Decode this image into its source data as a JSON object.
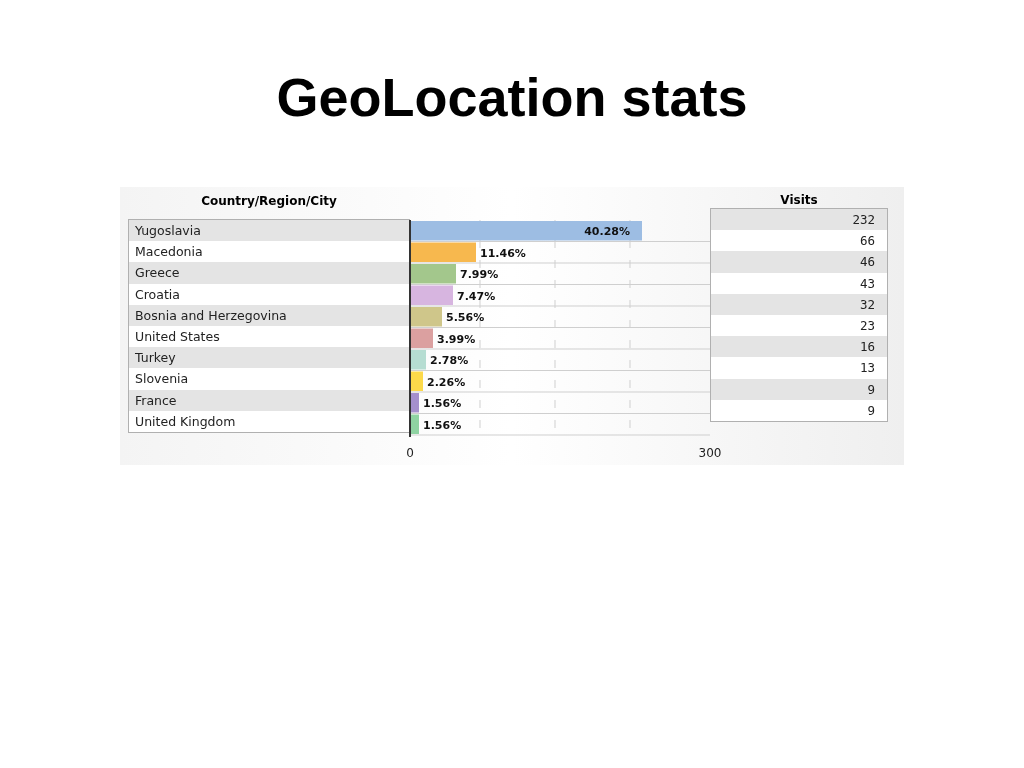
{
  "slide": {
    "title": "GeoLocation stats"
  },
  "report": {
    "country_heading": "Country/Region/City",
    "visits_heading": "Visits",
    "rows": [
      {
        "country": "Yugoslavia",
        "visits": "232",
        "color": "#9dbde3"
      },
      {
        "country": "Macedonia",
        "visits": "66",
        "color": "#f7b84e"
      },
      {
        "country": "Greece",
        "visits": "46",
        "color": "#a3c78c"
      },
      {
        "country": "Croatia",
        "visits": "43",
        "color": "#d7b5e0"
      },
      {
        "country": "Bosnia and Herzegovina",
        "visits": "32",
        "color": "#cfc68a"
      },
      {
        "country": "United States",
        "visits": "23",
        "color": "#dba0a0"
      },
      {
        "country": "Turkey",
        "visits": "16",
        "color": "#b6ddd2"
      },
      {
        "country": "Slovenia",
        "visits": "13",
        "color": "#fcd94a"
      },
      {
        "country": "France",
        "visits": "9",
        "color": "#a590cc"
      },
      {
        "country": "United Kingdom",
        "visits": "9",
        "color": "#8fd3a2"
      }
    ],
    "chart_data": {
      "type": "bar",
      "orientation": "horizontal",
      "xlim": [
        0,
        300
      ],
      "xticks": [
        0,
        300
      ],
      "series": [
        {
          "values": [
            232,
            66,
            46,
            43,
            32,
            23,
            16,
            13,
            9,
            9
          ]
        }
      ],
      "value_labels": [
        "40.28%",
        "11.46%",
        "7.99%",
        "7.47%",
        "5.56%",
        "3.99%",
        "2.78%",
        "2.26%",
        "1.56%",
        "1.56%"
      ]
    }
  }
}
